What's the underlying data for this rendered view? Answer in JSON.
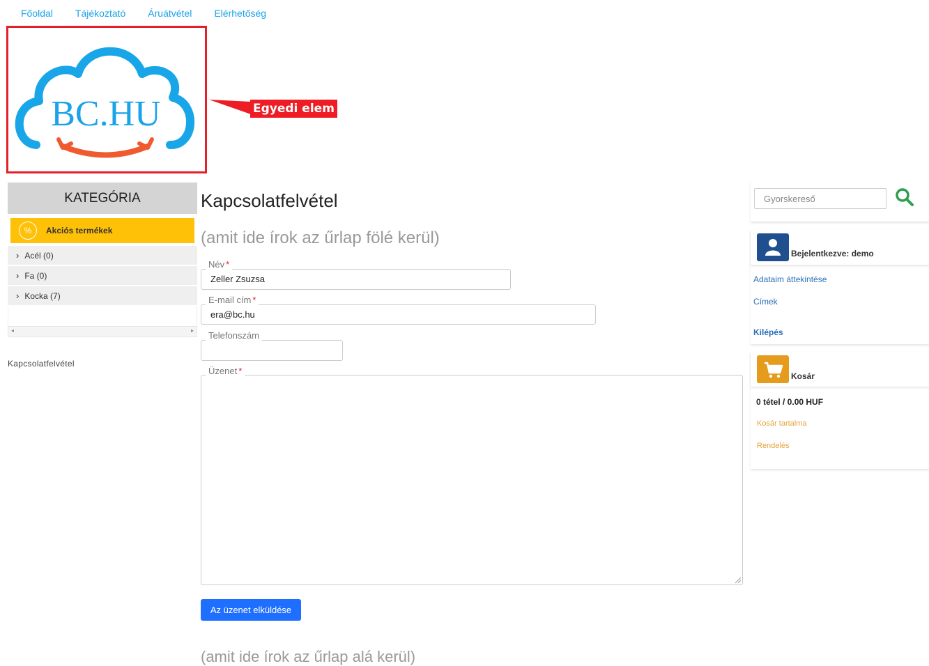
{
  "nav": {
    "items": [
      "Főoldal",
      "Tájékoztató",
      "Áruátvétel",
      "Elérhetőség"
    ]
  },
  "logo": {
    "text": "BC.HU"
  },
  "callout": {
    "label": "Egyedi elem"
  },
  "category": {
    "header": "KATEGÓRIA",
    "promo_label": "Akciós termékek",
    "promo_icon": "%",
    "items": [
      "Acél (0)",
      "Fa (0)",
      "Kocka (7)"
    ]
  },
  "breadcrumb": "Kapcsolatfelvétel",
  "main": {
    "title": "Kapcsolatfelvétel",
    "intro": "(amit ide írok az űrlap fölé kerül)",
    "outro": "(amit ide írok az űrlap alá kerül)",
    "form": {
      "name_label": "Név",
      "name_value": "Zeller Zsuzsa",
      "email_label": "E-mail cím",
      "email_value": "era@bc.hu",
      "phone_label": "Telefonszám",
      "phone_value": "",
      "message_label": "Üzenet",
      "required_mark": "*",
      "submit_label": "Az üzenet elküldése"
    }
  },
  "sidebar": {
    "search_placeholder": "Gyorskereső",
    "user": {
      "title": "Bejelentkezve: demo",
      "links": [
        "Adataim áttekintése",
        "Címek",
        "Kilépés"
      ]
    },
    "cart": {
      "title": "Kosár",
      "summary": "0 tétel / 0.00 HUF",
      "links": [
        "Kosár tartalma",
        "Rendelés"
      ]
    }
  },
  "colors": {
    "nav_link": "#1aa3e8",
    "highlight_red": "#ee1c24",
    "promo_yellow": "#ffc107",
    "primary_button": "#1e6fff",
    "search_green": "#2e9e4f",
    "user_icon_blue": "#1f4f8f",
    "cart_orange": "#e59b1c"
  }
}
